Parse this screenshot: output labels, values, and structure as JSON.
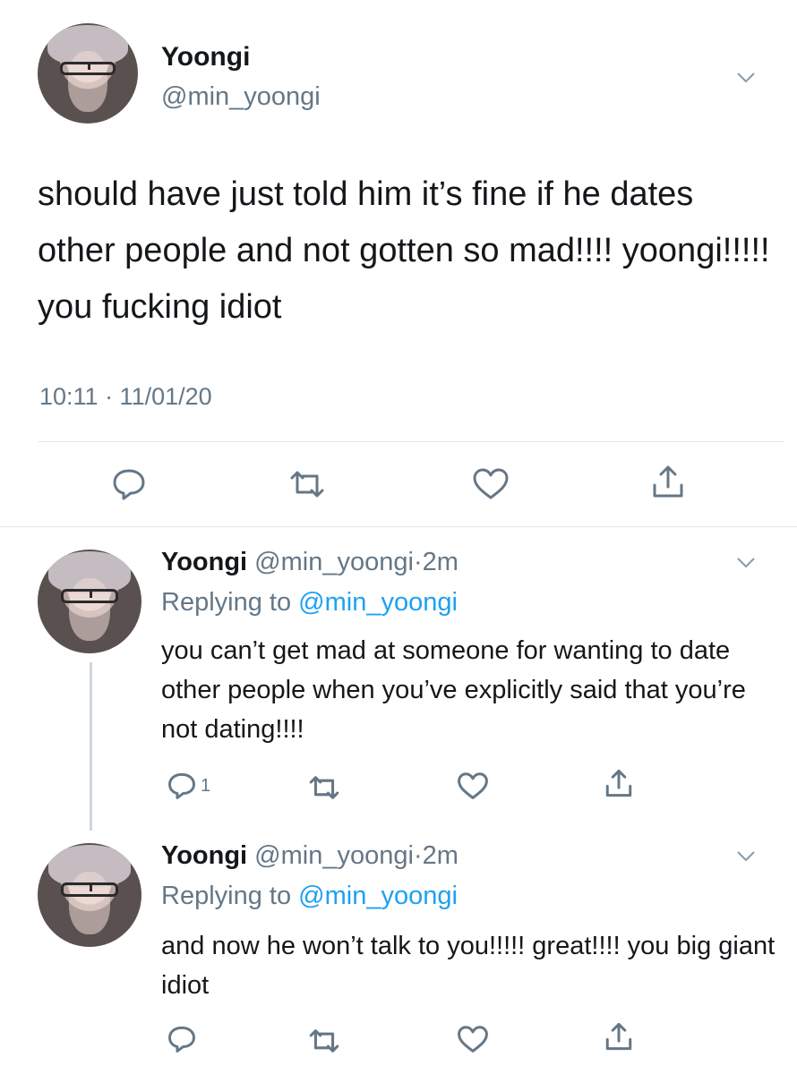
{
  "main_tweet": {
    "display_name": "Yoongi",
    "handle": "@min_yoongi",
    "text": "should have just told him it’s fine if he dates other people and not gotten so mad!!!! yoongi!!!!! you fucking idiot",
    "timestamp": "10:11 · 11/01/20"
  },
  "replies": [
    {
      "display_name": "Yoongi",
      "handle": "@min_yoongi",
      "separator": "·",
      "time": "2m",
      "replying_prefix": "Replying to",
      "replying_to": "@min_yoongi",
      "text": "you can’t get mad at someone for wanting to date other people when you’ve explicitly said that you’re not dating!!!!",
      "reply_count": "1"
    },
    {
      "display_name": "Yoongi",
      "handle": "@min_yoongi",
      "separator": "·",
      "time": "2m",
      "replying_prefix": "Replying to",
      "replying_to": "@min_yoongi",
      "text": "and now he won’t talk to you!!!!! great!!!! you big giant idiot"
    }
  ],
  "icons": {
    "reply": "reply-icon",
    "retweet": "retweet-icon",
    "like": "heart-icon",
    "share": "share-icon",
    "more": "chevron-down-icon"
  },
  "colors": {
    "text": "#14171a",
    "secondary": "#657786",
    "link": "#1da1f2",
    "divider": "#e1e8ed"
  }
}
